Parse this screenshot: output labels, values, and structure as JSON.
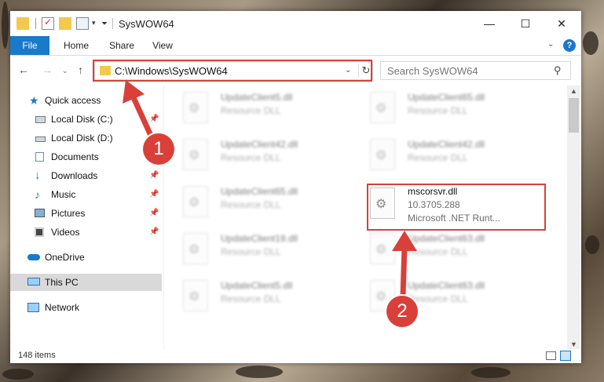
{
  "window": {
    "title": "SysWOW64",
    "controls": {
      "minimize": "—",
      "maximize": "☐",
      "close": "✕"
    }
  },
  "ribbon": {
    "tabs": [
      "File",
      "Home",
      "Share",
      "View"
    ],
    "help": "?"
  },
  "nav": {
    "back": "←",
    "forward": "→",
    "recent": "⌄",
    "up": "↑",
    "address": "C:\\Windows\\SysWOW64",
    "search_placeholder": "Search SysWOW64"
  },
  "sidebar": {
    "items": [
      {
        "label": "Quick access",
        "icon": "star-icon",
        "pinned": false
      },
      {
        "label": "Local Disk (C:)",
        "icon": "drive-icon",
        "pinned": true
      },
      {
        "label": "Local Disk (D:)",
        "icon": "drive-icon",
        "pinned": true
      },
      {
        "label": "Documents",
        "icon": "documents-icon",
        "pinned": true
      },
      {
        "label": "Downloads",
        "icon": "downloads-icon",
        "pinned": true
      },
      {
        "label": "Music",
        "icon": "music-icon",
        "pinned": true
      },
      {
        "label": "Pictures",
        "icon": "pictures-icon",
        "pinned": true
      },
      {
        "label": "Videos",
        "icon": "videos-icon",
        "pinned": true
      },
      {
        "label": "OneDrive",
        "icon": "onedrive-icon",
        "pinned": false
      },
      {
        "label": "This PC",
        "icon": "pc-icon",
        "pinned": false,
        "selected": true
      },
      {
        "label": "Network",
        "icon": "network-icon",
        "pinned": false
      }
    ]
  },
  "files": [
    {
      "name": "UpdateClient5.dll",
      "line1": "Resource DLL",
      "line2": "",
      "blurred": true
    },
    {
      "name": "UpdateClient65.dll",
      "line1": "Resource DLL",
      "line2": "",
      "blurred": true
    },
    {
      "name": "UpdateClient42.dll",
      "line1": "Resource DLL",
      "line2": "",
      "blurred": true
    },
    {
      "name": "UpdateClient42.dll",
      "line1": "Resource DLL",
      "line2": "",
      "blurred": true
    },
    {
      "name": "UpdateClient65.dll",
      "line1": "Resource DLL",
      "line2": "",
      "blurred": true
    },
    {
      "name": "mscorsvr.dll",
      "line1": "10.3705.288",
      "line2": "Microsoft .NET Runt...",
      "blurred": false
    },
    {
      "name": "UpdateClient19.dll",
      "line1": "Resource DLL",
      "line2": "",
      "blurred": true
    },
    {
      "name": "UpdateClient63.dll",
      "line1": "Resource DLL",
      "line2": "",
      "blurred": true
    },
    {
      "name": "UpdateClient5.dll",
      "line1": "Resource DLL",
      "line2": "",
      "blurred": true
    },
    {
      "name": "UpdateClient63.dll",
      "line1": "Resource DLL",
      "line2": "",
      "blurred": true
    }
  ],
  "status": {
    "item_count": "148 items"
  },
  "annotations": {
    "step1": "1",
    "step2": "2",
    "color": "#d9403a"
  },
  "colors": {
    "accent": "#1979ca",
    "highlight": "#d9403a",
    "selected_nav": "#d9d9d9"
  }
}
